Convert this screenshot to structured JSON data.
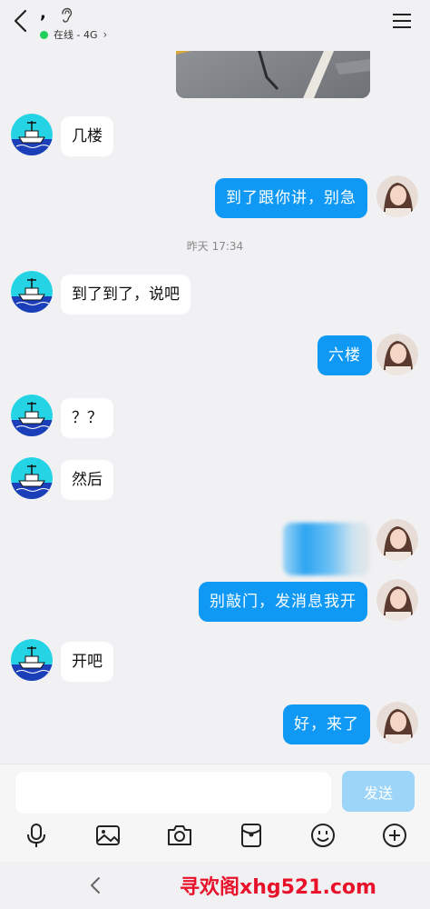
{
  "header": {
    "title": ",",
    "status_text": "在线 - 4G",
    "status_color": "#1fd15a",
    "icons": {
      "back": "chevron-left-icon",
      "ear": "ear-icon",
      "menu": "hamburger-menu-icon",
      "status_chevron": "chevron-right-icon"
    }
  },
  "messages": {
    "m1": "几楼",
    "m2": "到了跟你讲，别急",
    "time1": "昨天 17:34",
    "m3": "到了到了，说吧",
    "m4": "六楼",
    "m5": "？？",
    "m6": "然后",
    "m7": "别敲门，发消息我开",
    "m8": "开吧",
    "m9": "好，来了"
  },
  "composer": {
    "input_value": "",
    "send_label": "发送",
    "tools": [
      "microphone-icon",
      "image-icon",
      "camera-icon",
      "red-packet-icon",
      "emoji-icon",
      "plus-icon"
    ]
  },
  "watermark": "寻欢阁xhg521.com",
  "colors": {
    "out_bubble": "#0f99f5",
    "in_bubble": "#ffffff",
    "background": "#f1f1f3",
    "send_button": "#9dd5f8",
    "watermark": "#e8132a"
  }
}
